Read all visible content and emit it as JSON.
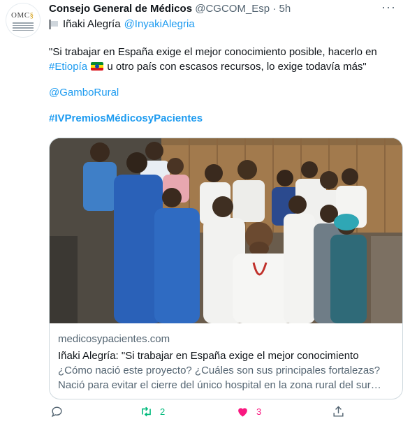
{
  "tweet": {
    "author_name": "Consejo General de Médicos",
    "author_handle": "@CGCOM_Esp",
    "separator": "·",
    "time": "5h",
    "avatar_text_main": "OMC",
    "avatar_text_accent": "§",
    "mention_line": {
      "name": "Iñaki Alegría",
      "handle": "@InyakiAlegria"
    },
    "body": {
      "line1_before": "\"Si trabajar en España exige el mejor conocimiento posible, hacerlo en",
      "hashtag_etiopia": "#Etiopía",
      "line2_after": "u otro país con escasos recursos, lo exige todavía más\"",
      "mention_gambo": "@GamboRural",
      "hashtag_premios": "#IVPremiosMédicosyPacientes"
    },
    "card": {
      "domain": "medicosypacientes.com",
      "title": "Iñaki Alegría: \"Si trabajar en España exige el mejor conocimiento",
      "description": "¿Cómo nació este proyecto? ¿Cuáles son sus principales fortalezas? Nació para evitar el cierre del único hospital en la zona rural del sur de..."
    },
    "actions": {
      "reply_count": "",
      "retweet_count": "2",
      "like_count": "3"
    }
  },
  "colors": {
    "link": "#1d9bf0",
    "retweet": "#00ba7c",
    "like": "#f91880",
    "muted": "#536471"
  },
  "icons": [
    "more-icon",
    "reply-icon",
    "retweet-icon",
    "heart-icon",
    "share-icon",
    "ethiopia-flag-icon",
    "verified-flag-icon"
  ]
}
